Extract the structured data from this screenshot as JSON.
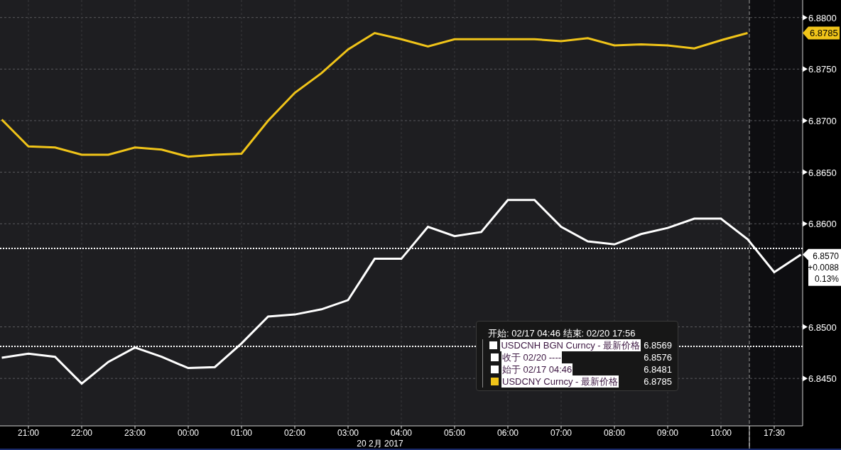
{
  "chart_data": {
    "type": "line",
    "xlabel": "20 2月 2017",
    "categories": [
      null,
      "21:00",
      null,
      "22:00",
      null,
      "23:00",
      null,
      "00:00",
      null,
      "01:00",
      null,
      "02:00",
      null,
      "03:00",
      null,
      "04:00",
      null,
      "05:00",
      null,
      "06:00",
      null,
      "07:00",
      null,
      "08:00",
      null,
      "09:00",
      null,
      "10:00",
      null,
      "17:30",
      null
    ],
    "grid": true,
    "ref_lines": [
      {
        "axis": "y",
        "value": 6.8576,
        "color": "#ffffff"
      },
      {
        "axis": "y",
        "value": 6.8481,
        "color": "#ffffff"
      }
    ],
    "series": [
      {
        "name": "USDCNH BGN Curncy - 最新价格",
        "color": "#ffffff",
        "values": [
          6.847,
          6.8474,
          6.8471,
          6.8445,
          6.8466,
          6.848,
          6.8471,
          6.846,
          6.8461,
          6.8484,
          6.851,
          6.8512,
          6.8517,
          6.8526,
          6.8566,
          6.8566,
          6.8597,
          6.8588,
          6.8592,
          6.8623,
          6.8623,
          6.8597,
          6.8583,
          6.858,
          6.859,
          6.8596,
          6.8605,
          6.8605,
          6.8585,
          6.8553,
          6.857
        ]
      },
      {
        "name": "USDCNY Curncy - 最新价格",
        "color": "#f0c419",
        "values": [
          6.8701,
          6.8675,
          6.8674,
          6.8667,
          6.8667,
          6.8674,
          6.8672,
          6.8665,
          6.8667,
          6.8668,
          6.87,
          6.8727,
          6.8746,
          6.8769,
          6.8785,
          6.8779,
          6.8772,
          6.8779,
          6.8779,
          6.8779,
          6.8779,
          6.8777,
          6.878,
          6.8773,
          6.8774,
          6.8773,
          6.877,
          6.8778,
          6.8785,
          null,
          null
        ]
      }
    ],
    "ylim": [
      6.8404,
      6.8817
    ],
    "yticks": [
      {
        "value": 6.845,
        "label": "6.8450"
      },
      {
        "value": 6.85,
        "label": "6.8500"
      },
      {
        "value": 6.86,
        "label": "6.8600"
      },
      {
        "value": 6.865,
        "label": "6.8650"
      },
      {
        "value": 6.87,
        "label": "6.8700"
      },
      {
        "value": 6.875,
        "label": "6.8750"
      },
      {
        "value": 6.88,
        "label": "6.8800"
      }
    ]
  },
  "price_tags": [
    {
      "kind": "series",
      "color": "#f0c419",
      "lines": [
        "6.8785"
      ]
    },
    {
      "kind": "box",
      "color": "#ffffff",
      "lines": [
        "6.8570",
        "+0.0088",
        "0.13%"
      ]
    }
  ],
  "legend": {
    "header": "开始: 02/17 04:46 结束: 02/20 17:56",
    "rows": [
      {
        "kind": "series",
        "value": "6.8569"
      },
      {
        "kind": "close",
        "label": "收于 02/20 ----",
        "value": "6.8576",
        "color": "#ffffff"
      },
      {
        "kind": "open",
        "label": "始于 02/17 04:46",
        "value": "6.8481",
        "color": "#ffffff"
      },
      {
        "kind": "series",
        "value": "6.8785"
      }
    ]
  }
}
